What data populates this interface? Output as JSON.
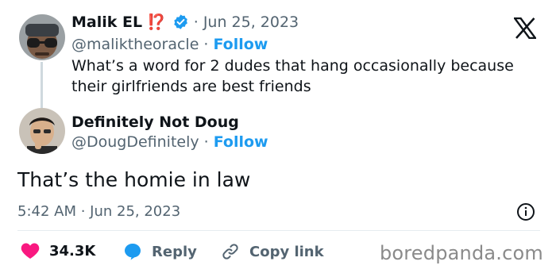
{
  "tweet": {
    "author": {
      "name": "Malik EL",
      "name_suffix": "⁉️",
      "handle": "@maliktheoracle",
      "date": "Jun 25, 2023",
      "follow_label": "Follow"
    },
    "text": "What’s a word for 2 dudes that hang occasionally because their girlfriends are best friends"
  },
  "reply": {
    "author": {
      "name": "Definitely Not Doug",
      "handle": "@DougDefinitely",
      "follow_label": "Follow"
    },
    "text": "That’s the homie in law",
    "timestamp": "5:42 AM · Jun 25, 2023"
  },
  "actions": {
    "likes": "34.3K",
    "reply_label": "Reply",
    "copy_link_label": "Copy link"
  },
  "watermark": "boredpanda.com",
  "separator": "·",
  "icons": {
    "verified": "verified-badge-icon",
    "x_logo": "x-logo-icon",
    "info": "info-icon",
    "heart": "heart-icon",
    "reply": "reply-bubble-icon",
    "link": "link-icon"
  },
  "colors": {
    "follow": "#1d9bf0",
    "verified": "#1d9bf0",
    "heart": "#f91880",
    "secondary_text": "#536471"
  }
}
